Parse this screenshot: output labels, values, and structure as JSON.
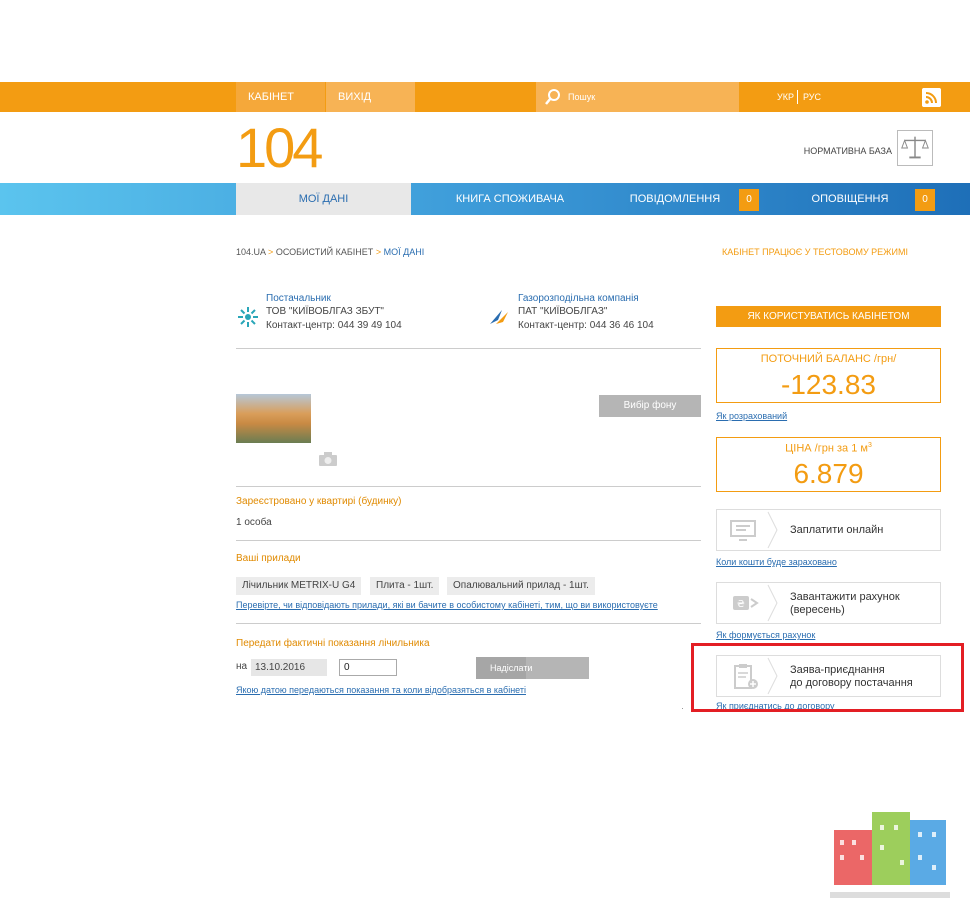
{
  "topbar": {
    "cabinet": "КАБІНЕТ",
    "exit": "ВИХІД",
    "search_placeholder": "Пошук",
    "lang_ukr": "УКР",
    "lang_rus": "РУС"
  },
  "logo": "104",
  "norm_base": "НОРМАТИВНА БАЗА",
  "nav": {
    "my_data": "МОЇ ДАНІ",
    "book": "КНИГА СПОЖИВАЧА",
    "messages": "ПОВІДОМЛЕННЯ",
    "messages_count": "0",
    "notifications": "ОПОВІЩЕННЯ",
    "notifications_count": "0"
  },
  "breadcrumb": {
    "home": "104.UA",
    "sep": ">",
    "cabinet": "ОСОБИСТИЙ КАБІНЕТ",
    "current": "МОЇ ДАНІ"
  },
  "test_mode": "КАБІНЕТ ПРАЦЮЄ У ТЕСТОВОМУ РЕЖИМІ",
  "providers": {
    "supplier_title": "Постачальник",
    "supplier_name": "ТОВ \"КИЇВОБЛГАЗ ЗБУТ\"",
    "supplier_phone": "Контакт-центр: 044 39 49 104",
    "distributor_title": "Газорозподільна компанія",
    "distributor_name": "ПАТ \"КИЇВОБЛГАЗ\"",
    "distributor_phone": "Контакт-центр: 044 36 46 104"
  },
  "background_button": "Вибір фону",
  "registered": {
    "title": "Зареєстровано у квартирі (будинку)",
    "value": "1 особа"
  },
  "devices": {
    "title": "Ваші прилади",
    "items": [
      "Лічильник METRIX-U G4",
      "Плита - 1шт.",
      "Опалювальний прилад - 1шт."
    ],
    "check_link": "Перевірте, чи відповідають прилади, які ви бачите в особистому кабінеті, тим, що ви використовуєте"
  },
  "meter": {
    "title": "Передати фактичні показання лічильника",
    "on_label": "на",
    "date": "13.10.2016",
    "value": "0",
    "send_button": "Надіслати",
    "info_link": "Якою датою передаються показання та коли відобразяться в кабінеті"
  },
  "right": {
    "how_to": "ЯК КОРИСТУВАТИСЬ КАБІНЕТОМ",
    "balance_label": "ПОТОЧНИЙ БАЛАНС /грн/",
    "balance_value": "-123.83",
    "balance_link": "Як розрахований",
    "price_label": "ЦІНА /грн за 1 м",
    "price_sup": "3",
    "price_value": "6.879",
    "pay_label": "Заплатити онлайн",
    "pay_link": "Коли кошти буде зараховано",
    "bill_label_1": "Завантажити рахунок",
    "bill_label_2": "(вересень)",
    "bill_link": "Як формується рахунок",
    "contract_label_1": "Заява-приєднання",
    "contract_label_2": "до договору постачання",
    "contract_link": "Як приєднатись до договору"
  },
  "colors": {
    "orange": "#f39c12",
    "blue_link": "#2a6db0",
    "highlight_red": "#e31e24"
  }
}
